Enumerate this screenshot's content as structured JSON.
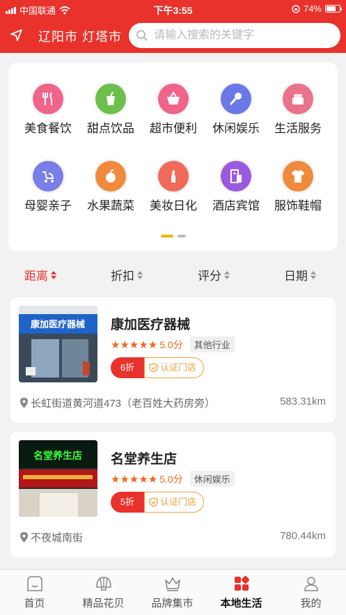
{
  "status": {
    "carrier": "中国联通",
    "time": "下午3:55",
    "battery": "74%",
    "battery_level": 0.74
  },
  "header": {
    "city": "辽阳市 灯塔市",
    "search_placeholder": "请输入搜索的关键字"
  },
  "categories": [
    {
      "label": "美食餐饮",
      "icon": "fork-knife-icon",
      "color": "#f0648a"
    },
    {
      "label": "甜点饮品",
      "icon": "drink-cup-icon",
      "color": "#6cc04a"
    },
    {
      "label": "超市便利",
      "icon": "basket-icon",
      "color": "#f0648a"
    },
    {
      "label": "休闲娱乐",
      "icon": "microphone-icon",
      "color": "#6b78e8"
    },
    {
      "label": "生活服务",
      "icon": "cake-icon",
      "color": "#e8738a"
    },
    {
      "label": "母婴亲子",
      "icon": "stroller-icon",
      "color": "#7a7ee8"
    },
    {
      "label": "水果蔬菜",
      "icon": "apple-icon",
      "color": "#f08a3c"
    },
    {
      "label": "美妆日化",
      "icon": "lipstick-icon",
      "color": "#f06a5a"
    },
    {
      "label": "酒店宾馆",
      "icon": "building-icon",
      "color": "#9a5ae0"
    },
    {
      "label": "服饰鞋帽",
      "icon": "shirt-icon",
      "color": "#f08a3c"
    }
  ],
  "sort": [
    "距离",
    "折扣",
    "评分",
    "日期"
  ],
  "stores": [
    {
      "name": "康加医疗器械",
      "stars": "★★★★★",
      "score": "5.0分",
      "category": "其他行业",
      "discount": "6折",
      "cert": "认证门店",
      "address": "长虹街道黄河道473（老百姓大药房旁）",
      "distance": "583.31km",
      "sign": "康加医疗器械"
    },
    {
      "name": "名堂养生店",
      "stars": "★★★★★",
      "score": "5.0分",
      "category": "休闲娱乐",
      "discount": "5折",
      "cert": "认证门店",
      "address": "不夜城南街",
      "distance": "780.44km",
      "sign": "名堂养生店"
    }
  ],
  "nav": [
    {
      "label": "首页",
      "icon": "home-icon"
    },
    {
      "label": "精品花贝",
      "icon": "shell-icon"
    },
    {
      "label": "品牌集市",
      "icon": "crown-icon"
    },
    {
      "label": "本地生活",
      "icon": "grid-icon"
    },
    {
      "label": "我的",
      "icon": "user-icon"
    }
  ],
  "colors": {
    "brand": "#e8322b",
    "star": "#f0671d",
    "cert": "#f0a038"
  }
}
